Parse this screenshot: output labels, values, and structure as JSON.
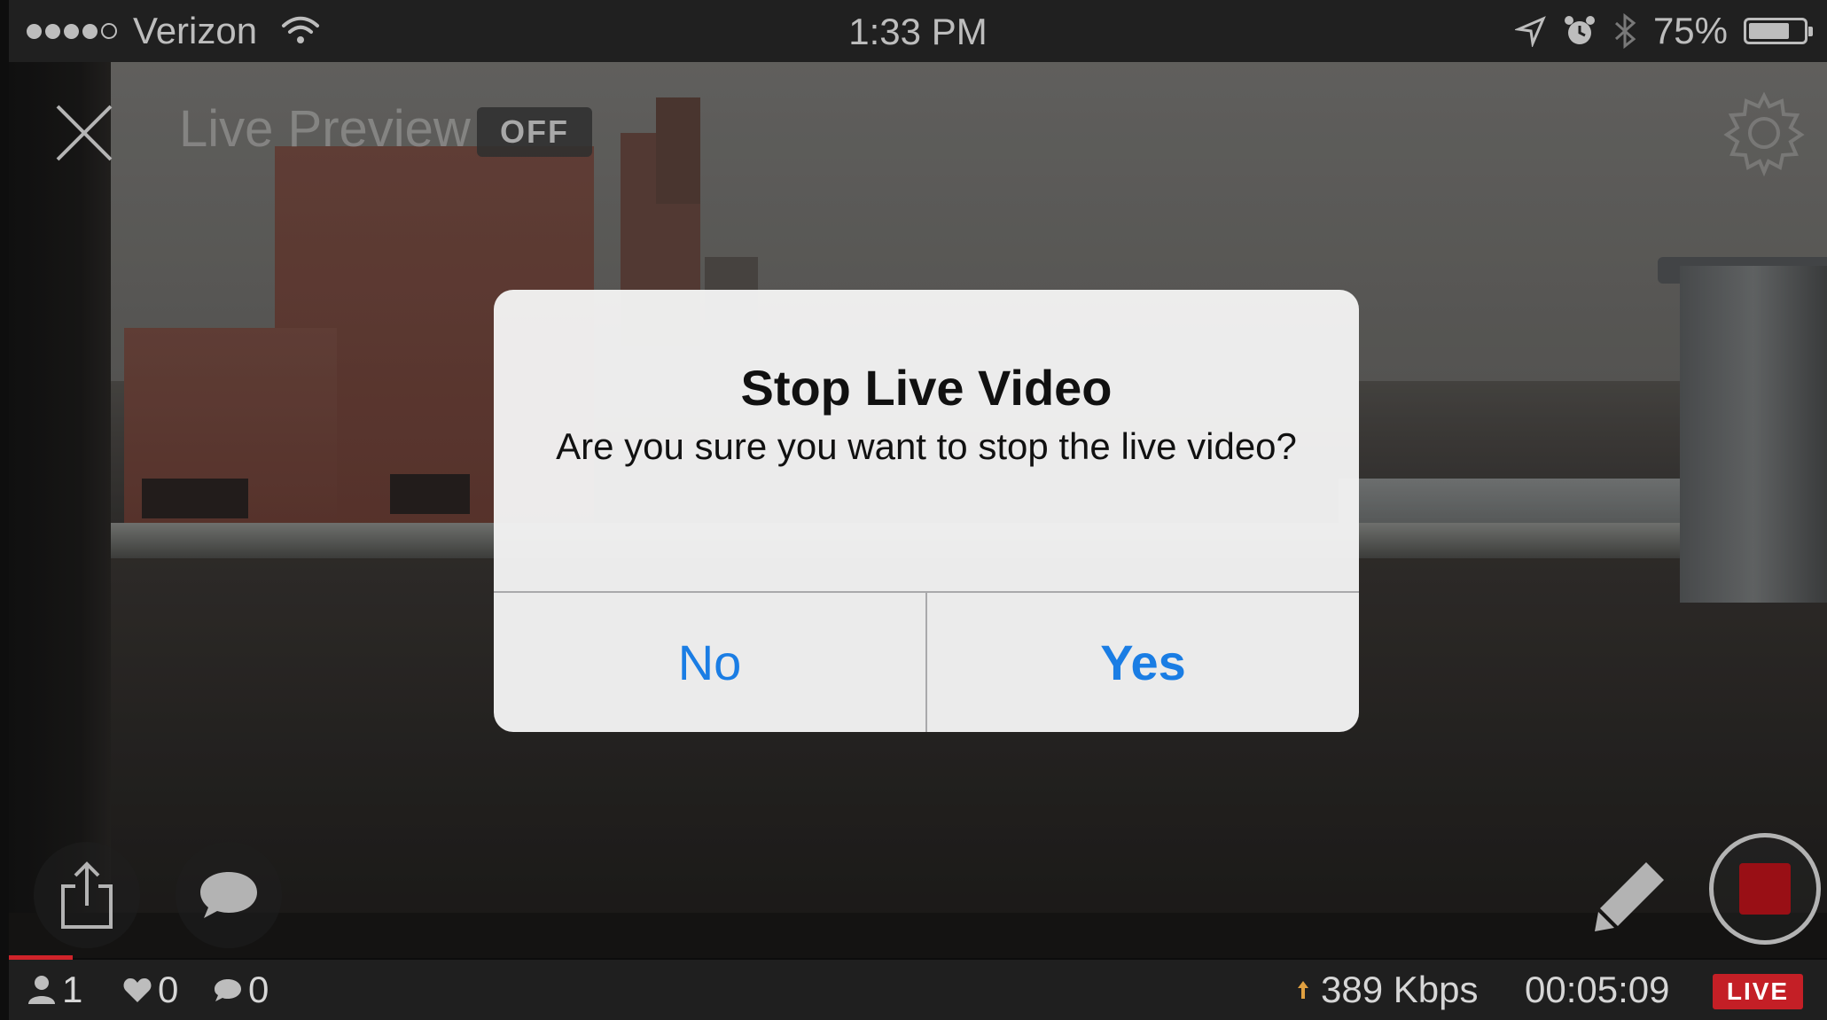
{
  "status_bar": {
    "carrier": "Verizon",
    "time": "1:33 PM",
    "battery": "75%",
    "battery_level": 0.75,
    "icons": [
      "signal-dots-icon",
      "wifi-icon",
      "location-arrow-icon",
      "alarm-icon",
      "bluetooth-icon",
      "battery-icon"
    ]
  },
  "overlay": {
    "live_preview_label": "Live Preview",
    "live_preview_state": "OFF"
  },
  "alert": {
    "title": "Stop Live Video",
    "message": "Are you sure you want to stop the live video?",
    "no_label": "No",
    "yes_label": "Yes"
  },
  "bottom_bar": {
    "viewers": "1",
    "likes": "0",
    "comments": "0",
    "bitrate": "389 Kbps",
    "duration": "00:05:09",
    "live_label": "LIVE"
  },
  "colors": {
    "accent_blue": "#1a7de4",
    "live_red": "#c41f26",
    "record_red": "#c4141c"
  }
}
